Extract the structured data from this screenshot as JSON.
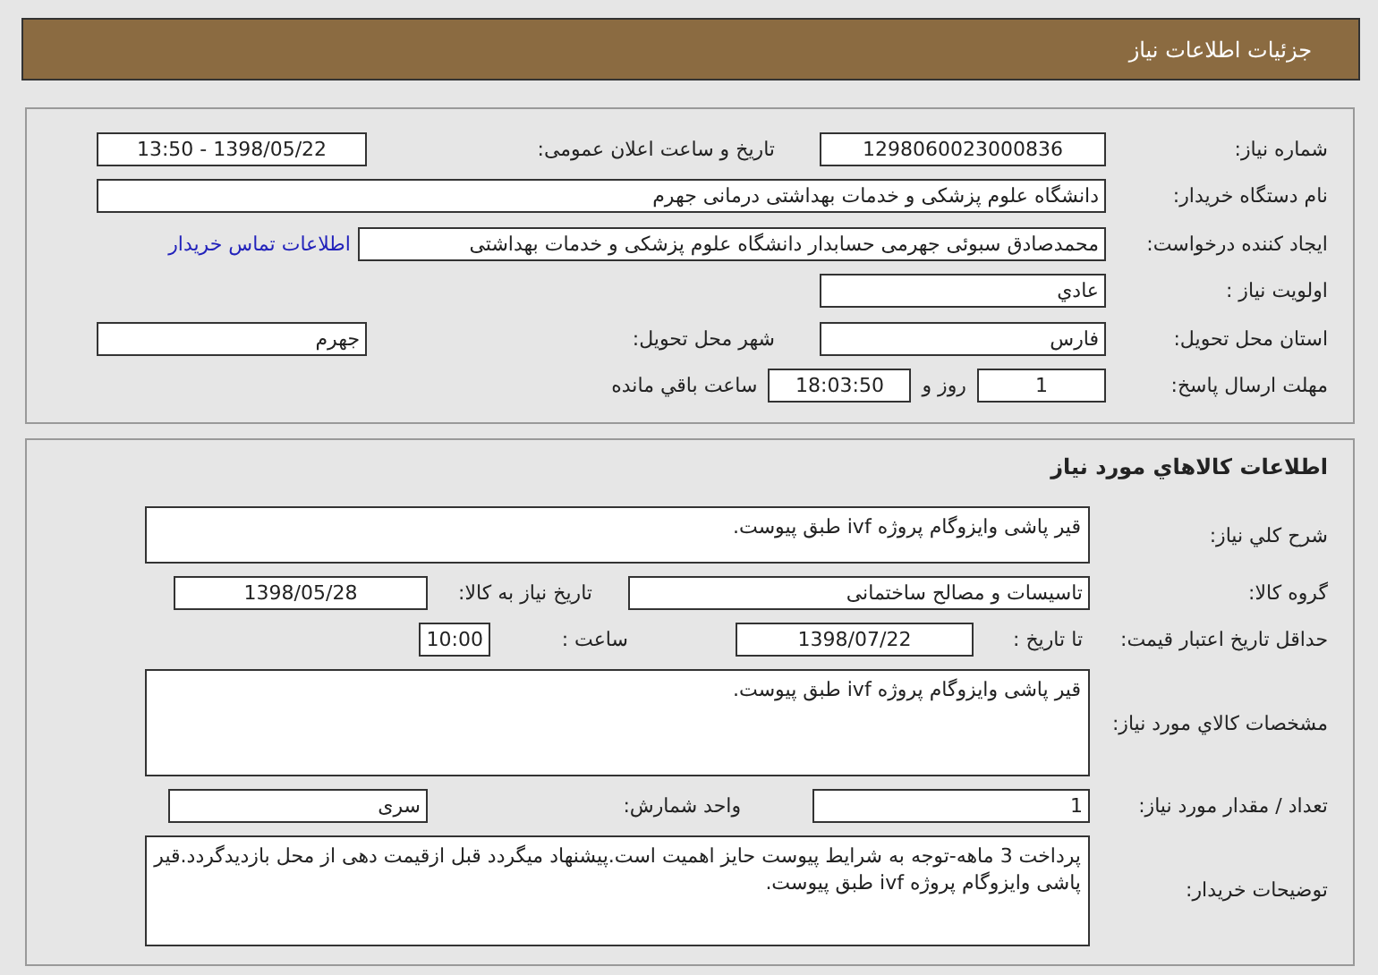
{
  "header": {
    "title": "جزئیات اطلاعات نیاز"
  },
  "need": {
    "need_number": {
      "label": "شماره نیاز:",
      "value": "1298060023000836"
    },
    "announce": {
      "label": "تاریخ و ساعت اعلان عمومی:",
      "value": "1398/05/22 - 13:50"
    },
    "buyer": {
      "label": "نام دستگاه خریدار:",
      "value": "دانشگاه علوم پزشکی و خدمات بهداشتی درمانی جهرم"
    },
    "creator": {
      "label": "ایجاد کننده درخواست:",
      "value": "محمدصادق  سبوئی جهرمی حسابدار دانشگاه علوم پزشکی و خدمات بهداشتی",
      "link": "اطلاعات تماس خریدار"
    },
    "priority": {
      "label": "اولویت نیاز :",
      "value": "عادي"
    },
    "province": {
      "label": "استان محل تحویل:",
      "value": "فارس"
    },
    "city": {
      "label": "شهر محل تحویل:",
      "value": "جهرم"
    },
    "deadline": {
      "label": "مهلت ارسال پاسخ:",
      "days": "1",
      "days_label": "روز و",
      "time": "18:03:50",
      "time_label": "ساعت باقي مانده"
    }
  },
  "goods": {
    "title": "اطلاعات کالاهاي مورد نياز",
    "description": {
      "label": "شرح کلي نیاز:",
      "value": "قیر پاشی وایزوگام پروژه ivf طبق پیوست."
    },
    "group": {
      "label": "گروه کالا:",
      "value": "تاسیسات و مصالح ساختمانی"
    },
    "need_date": {
      "label": "تاریخ نیاز به کالا:",
      "value": "1398/05/28"
    },
    "validity": {
      "label": "حداقل تاریخ اعتبار قیمت:",
      "date_label": "تا تاریخ :",
      "date": "1398/07/22",
      "time_label": "ساعت :",
      "time": "10:00"
    },
    "specs": {
      "label": "مشخصات کالاي مورد نياز:",
      "value": "قیر پاشی وایزوگام پروژه ivf طبق پیوست."
    },
    "quantity": {
      "label": "تعداد / مقدار مورد نیاز:",
      "value": "1"
    },
    "unit": {
      "label": "واحد شمارش:",
      "value": "سری"
    },
    "buyer_notes": {
      "label": "توضیحات خریدار:",
      "value": "پرداخت 3 ماهه-توجه به شرایط پیوست حایز اهمیت است.پیشنهاد میگردد قبل ازقیمت دهی از محل بازدیدگردد.قیر پاشی وایزوگام پروژه ivf طبق پیوست."
    }
  }
}
